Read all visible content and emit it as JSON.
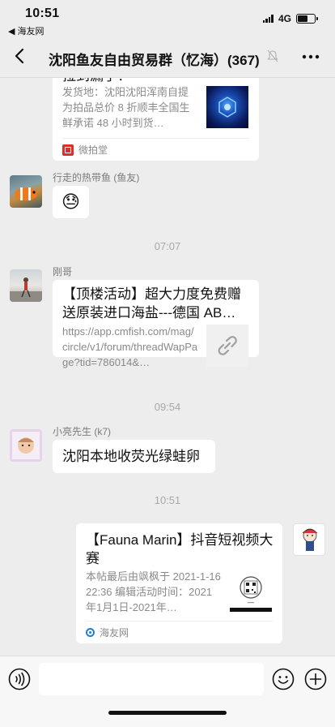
{
  "status": {
    "time": "10:51",
    "back_app": "◀ 海友网",
    "network": "4G"
  },
  "nav": {
    "title": "沈阳鱼友自由贸易群（忆海）(367)"
  },
  "messages": {
    "top_card": {
      "title_partial": "拉到漏了！",
      "desc": "发货地：沈阳沈阳浑南自提为拍品总价 8 折顺丰全国生鲜承诺 48 小时到货…",
      "source": "微拍堂"
    },
    "msg1": {
      "sender": "行走的热带鱼 (鱼友)",
      "emoji": "😓"
    },
    "ts1": "07:07",
    "msg2": {
      "sender": "刚哥",
      "title": "【顶楼活动】超大力度免费赠送原装进口海盐---德国 AB…",
      "url": "https://app.cmfish.com/mag/circle/v1/forum/threadWapPage?tid=786014&…"
    },
    "ts2": "09:54",
    "msg3": {
      "sender": "小亮先生 (k7)",
      "text": "沈阳本地收荧光绿蛙卵"
    },
    "ts3": "10:51",
    "msg4": {
      "title": "【Fauna Marin】抖音短视频大赛",
      "desc": "本帖最后由飒枫于 2021-1-1622:36 编辑活动时间：2021年1月1日-2021年…",
      "source": "海友网"
    }
  }
}
